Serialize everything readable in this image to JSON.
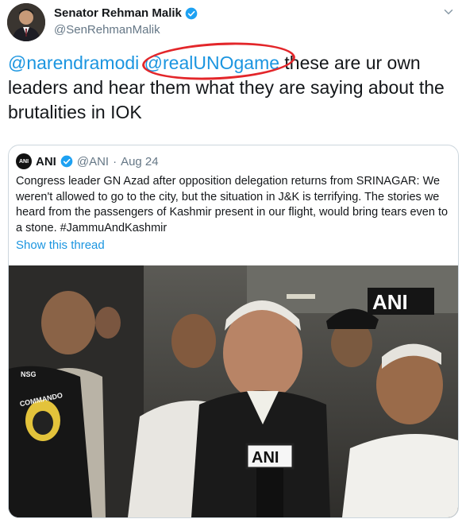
{
  "author": {
    "name": "Senator Rehman Malik",
    "handle": "@SenRehmanMalik"
  },
  "tweet": {
    "mention1": "@narendramodi",
    "mention2": "@realUNOgame",
    "text": " these are ur own leaders  and hear them  what they are saying  about the brutalities in IOK"
  },
  "quoted": {
    "logo_text": "ANI",
    "name": "ANI",
    "handle": "@ANI",
    "date": "Aug 24",
    "text": "Congress leader GN Azad after opposition delegation returns from SRINAGAR: We weren't allowed to go to the city, but the situation in J&K is terrifying. The stories we heard from the passengers of Kashmir present in our flight, would bring tears even to a stone. #JammuAndKashmir",
    "show_thread": "Show this thread",
    "photo": {
      "watermark": "ANI",
      "mic_label": "ANI",
      "badge_text": "COMMANDO",
      "badge_top": "NSG"
    }
  },
  "colors": {
    "link": "#1b95e0",
    "verified": "#1da1f2",
    "annotation": "#e3262a"
  }
}
